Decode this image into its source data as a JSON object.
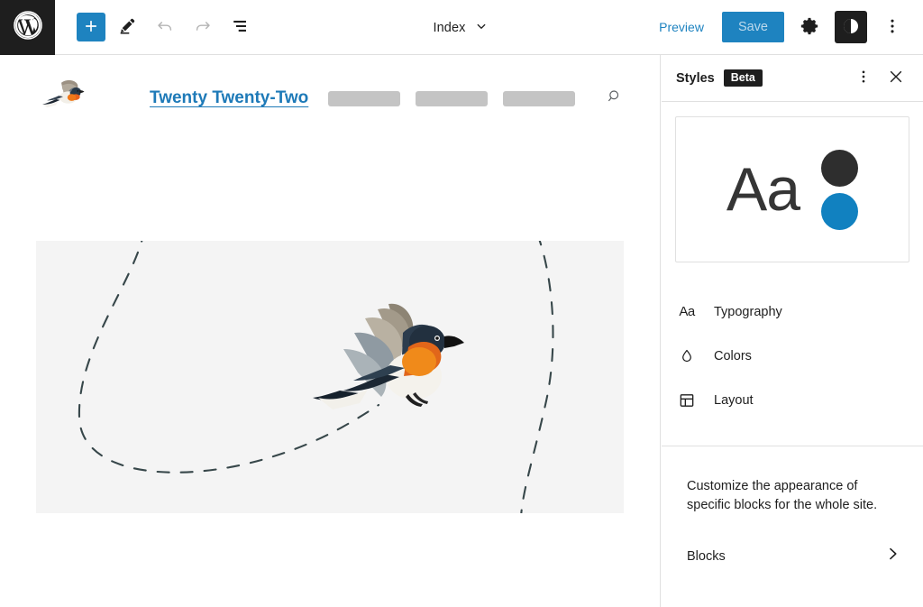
{
  "toolbar": {
    "wp_logo": "wordpress-logo",
    "add_label": "+",
    "add_title": "Add block",
    "edit_title": "Edit",
    "undo_title": "Undo",
    "redo_title": "Redo",
    "list_view_title": "List View",
    "document_title": "Index",
    "preview_label": "Preview",
    "save_label": "Save",
    "settings_title": "Settings",
    "styles_title": "Styles",
    "options_title": "Options",
    "accent_blue": "#1e83c0",
    "save_text_color": "#bcd9ec"
  },
  "canvas": {
    "site_title": "Twenty Twenty-Two",
    "site_title_color": "#1e7ab8",
    "logo_name": "bird-site-logo",
    "nav_placeholders": [
      "",
      "",
      ""
    ],
    "search_title": "Search",
    "hero_background": "#f4f4f4",
    "hero_image_alt": "flying bird with dashed flight path"
  },
  "sidebar": {
    "title": "Styles",
    "badge": "Beta",
    "more_menu_title": "More",
    "close_title": "Close Styles sidebar",
    "preview": {
      "sample_text": "Aa",
      "swatch_dark": "#2e2e2e",
      "swatch_blue": "#1181c0"
    },
    "menu": [
      {
        "label": "Typography",
        "icon": "typography-icon"
      },
      {
        "label": "Colors",
        "icon": "droplet-icon"
      },
      {
        "label": "Layout",
        "icon": "layout-icon"
      }
    ],
    "blocks": {
      "description": "Customize the appearance of specific blocks for the whole site.",
      "label": "Blocks",
      "chevron": "chevron-right-icon"
    }
  }
}
